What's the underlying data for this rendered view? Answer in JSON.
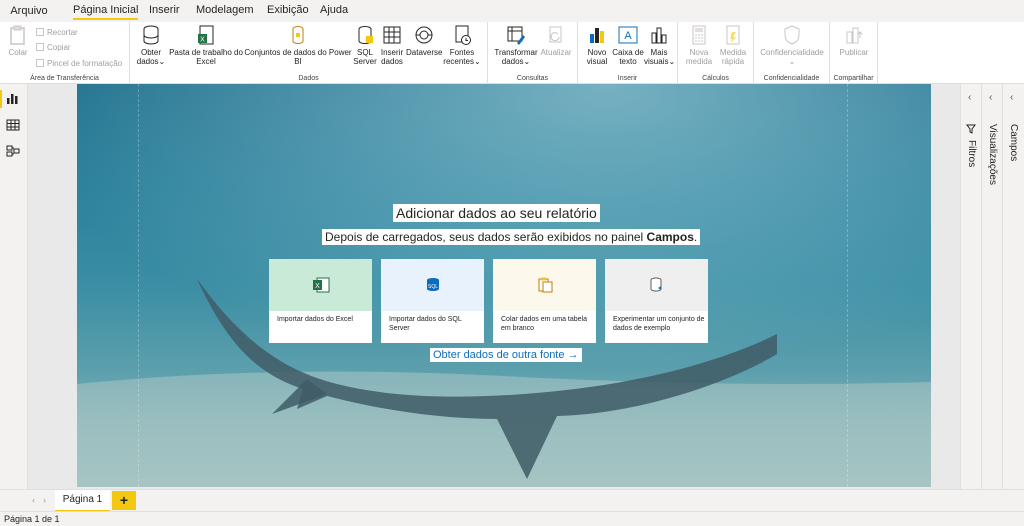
{
  "menu": {
    "tabs": [
      "Arquivo",
      "Página Inicial",
      "Inserir",
      "Modelagem",
      "Exibição",
      "Ajuda"
    ],
    "active": "Página Inicial"
  },
  "ribbon": {
    "clipboard": {
      "label": "Área de Transferência",
      "paste": "Colar",
      "cut": "Recortar",
      "copy": "Copiar",
      "format_painter": "Pincel de formatação"
    },
    "data": {
      "label": "Dados",
      "get_data_1": "Obter",
      "get_data_2": "dados",
      "excel_1": "Pasta de trabalho do",
      "excel_2": "Excel",
      "datasets_1": "Conjuntos de dados do Power",
      "datasets_2": "BI",
      "sql_1": "SQL",
      "sql_2": "Server",
      "enter_1": "Inserir",
      "enter_2": "dados",
      "dataverse": "Dataverse",
      "recent_1": "Fontes",
      "recent_2": "recentes"
    },
    "queries": {
      "label": "Consultas",
      "transform_1": "Transformar",
      "transform_2": "dados",
      "refresh": "Atualizar"
    },
    "insert": {
      "label": "Inserir",
      "visual_1": "Novo",
      "visual_2": "visual",
      "textbox_1": "Caixa de",
      "textbox_2": "texto",
      "more_1": "Mais",
      "more_2": "visuais"
    },
    "calculations": {
      "label": "Cálculos",
      "measure_1": "Nova",
      "measure_2": "medida",
      "quick_1": "Medida",
      "quick_2": "rápida"
    },
    "sensitivity": {
      "label": "Confidencialidade",
      "button": "Confidencialidade"
    },
    "share": {
      "label": "Compartilhar",
      "publish": "Publicar"
    }
  },
  "welcome": {
    "title": "Adicionar dados ao seu relatório",
    "subtitle_pre": "Depois de carregados, seus dados serão exibidos no painel ",
    "subtitle_bold": "Campos",
    "subtitle_post": ".",
    "cards": [
      {
        "label": "Importar dados do Excel",
        "icon": "excel-icon",
        "tint": "#c9ead6"
      },
      {
        "label": "Importar dados do SQL Server",
        "icon": "sql-server-icon",
        "tint": "#e8f2fc"
      },
      {
        "label": "Colar dados em uma tabela em branco",
        "icon": "paste-table-icon",
        "tint": "#fdf8ec"
      },
      {
        "label": "Experimentar um conjunto de dados de exemplo",
        "icon": "sample-dataset-icon",
        "tint": "#efefef"
      }
    ],
    "other_source": "Obter dados de outra fonte →"
  },
  "panes": {
    "filters": "Filtros",
    "visualizations": "Visualizações",
    "fields": "Campos"
  },
  "pages": {
    "tabs": [
      "Página 1"
    ],
    "add": "+"
  },
  "status": {
    "page_indicator": "Página 1 de 1"
  },
  "colors": {
    "accent": "#f2c811",
    "link": "#0f6cbd"
  }
}
